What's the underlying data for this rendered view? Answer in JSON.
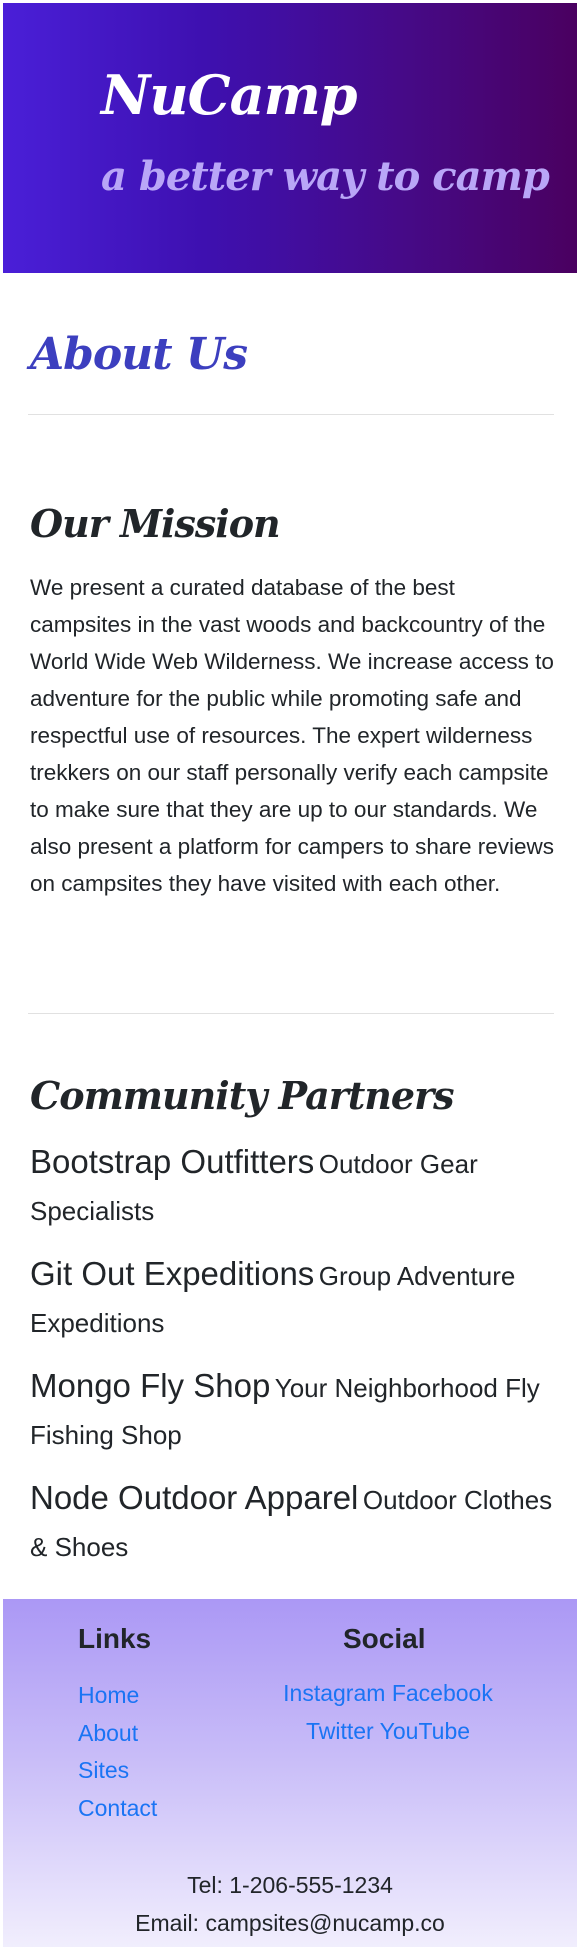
{
  "header": {
    "brand": "NuCamp",
    "tagline": "a better way to camp",
    "gradient_colors": [
      "#4a1fd8",
      "#4a0060"
    ]
  },
  "about": {
    "title": "About Us"
  },
  "mission": {
    "title": "Our Mission",
    "text": "We present a curated database of the best campsites in the vast woods and backcountry of the World Wide Web Wilderness. We increase access to adventure for the public while promoting safe and respectful use of resources. The expert wilderness trekkers on our staff personally verify each campsite to make sure that they are up to our standards. We also present a platform for campers to share reviews on campsites they have visited with each other."
  },
  "partners": {
    "title": "Community Partners",
    "items": [
      {
        "name": "Bootstrap Outfitters",
        "desc": "Outdoor Gear Specialists"
      },
      {
        "name": "Git Out Expeditions",
        "desc": "Group Adventure Expeditions"
      },
      {
        "name": "Mongo Fly Shop",
        "desc": "Your Neighborhood Fly Fishing Shop"
      },
      {
        "name": "Node Outdoor Apparel",
        "desc": "Outdoor Clothes & Shoes"
      }
    ]
  },
  "footer": {
    "links_heading": "Links",
    "links": [
      "Home",
      "About",
      "Sites",
      "Contact"
    ],
    "social_heading": "Social",
    "social": [
      "Instagram",
      "Facebook",
      "Twitter",
      "YouTube"
    ],
    "tel": "Tel: 1-206-555-1234",
    "email": "Email: campsites@nucamp.co",
    "link_color": "#1a74f4"
  }
}
